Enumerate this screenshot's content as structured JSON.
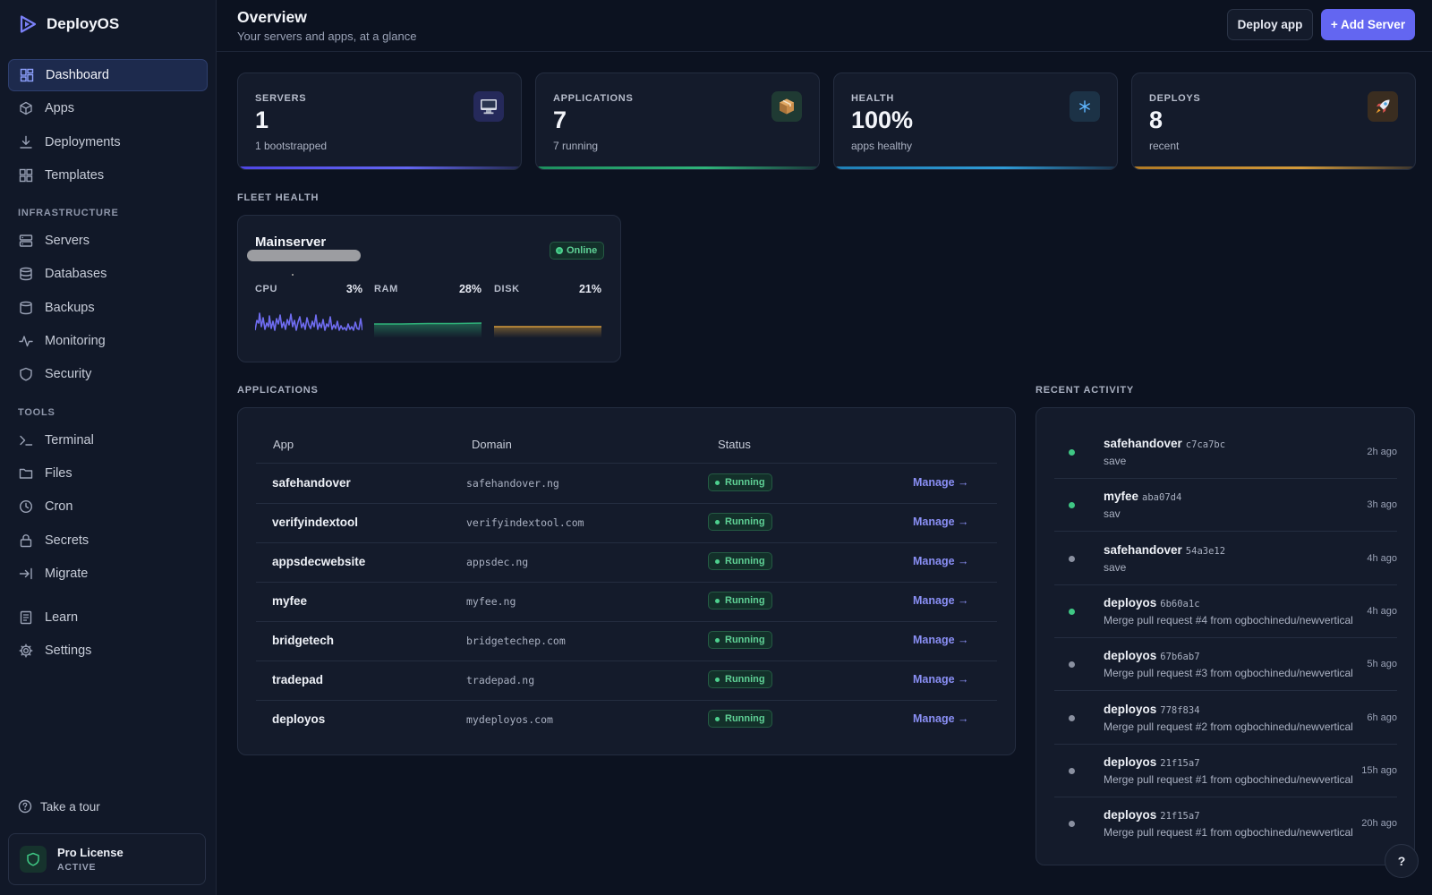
{
  "app": {
    "name": "DeployOS"
  },
  "nav": {
    "main": [
      {
        "label": "Dashboard",
        "icon": "dashboard-icon",
        "active": true
      },
      {
        "label": "Apps",
        "icon": "cube-icon"
      },
      {
        "label": "Deployments",
        "icon": "download-icon"
      },
      {
        "label": "Templates",
        "icon": "grid-icon"
      }
    ],
    "infrastructure_label": "INFRASTRUCTURE",
    "infrastructure": [
      {
        "label": "Servers",
        "icon": "server-icon"
      },
      {
        "label": "Databases",
        "icon": "database-icon"
      },
      {
        "label": "Backups",
        "icon": "backup-icon"
      },
      {
        "label": "Monitoring",
        "icon": "activity-icon"
      },
      {
        "label": "Security",
        "icon": "shield-icon"
      }
    ],
    "tools_label": "TOOLS",
    "tools": [
      {
        "label": "Terminal",
        "icon": "terminal-icon"
      },
      {
        "label": "Files",
        "icon": "folder-icon"
      },
      {
        "label": "Cron",
        "icon": "clock-icon"
      },
      {
        "label": "Secrets",
        "icon": "lock-icon"
      },
      {
        "label": "Migrate",
        "icon": "migrate-icon"
      }
    ],
    "bottom": [
      {
        "label": "Learn",
        "icon": "book-icon"
      },
      {
        "label": "Settings",
        "icon": "gear-icon"
      }
    ],
    "tour_label": "Take a tour",
    "license": {
      "title": "Pro License",
      "status": "ACTIVE"
    }
  },
  "header": {
    "title": "Overview",
    "subtitle": "Your servers and apps, at a glance",
    "deploy_label": "Deploy app",
    "add_server_label": "+ Add Server"
  },
  "stats": [
    {
      "label": "SERVERS",
      "value": "1",
      "sub": "1 bootstrapped",
      "icon": "monitor-icon",
      "accent": "#6366f1",
      "icon_bg": "#25295a"
    },
    {
      "label": "APPLICATIONS",
      "value": "7",
      "sub": "7 running",
      "icon": "package-icon",
      "accent": "#2fb37a",
      "icon_bg": "#1f3a33"
    },
    {
      "label": "HEALTH",
      "value": "100%",
      "sub": "apps healthy",
      "icon": "snowflake-icon",
      "accent": "#2f9bd6",
      "icon_bg": "#1c3246"
    },
    {
      "label": "DEPLOYS",
      "value": "8",
      "sub": "recent",
      "icon": "rocket-icon",
      "accent": "#d39a3a",
      "icon_bg": "#3a2d20"
    }
  ],
  "fleet": {
    "section_label": "FLEET HEALTH",
    "server_name": "Mainserver",
    "status": "Online",
    "metrics": [
      {
        "label": "CPU",
        "value": "3%",
        "color": "#6f6cf0",
        "percent": 3
      },
      {
        "label": "RAM",
        "value": "28%",
        "color": "#2fb37a",
        "percent": 28
      },
      {
        "label": "DISK",
        "value": "21%",
        "color": "#d39a3a",
        "percent": 21
      }
    ]
  },
  "applications": {
    "section_label": "APPLICATIONS",
    "headers": [
      "App",
      "Domain",
      "Status"
    ],
    "manage_label": "Manage →",
    "rows": [
      {
        "app": "safehandover",
        "domain": "safehandover.ng",
        "status": "Running"
      },
      {
        "app": "verifyindextool",
        "domain": "verifyindextool.com",
        "status": "Running"
      },
      {
        "app": "appsdecwebsite",
        "domain": "appsdec.ng",
        "status": "Running"
      },
      {
        "app": "myfee",
        "domain": "myfee.ng",
        "status": "Running"
      },
      {
        "app": "bridgetech",
        "domain": "bridgetechep.com",
        "status": "Running"
      },
      {
        "app": "tradepad",
        "domain": "tradepad.ng",
        "status": "Running"
      },
      {
        "app": "deployos",
        "domain": "mydeployos.com",
        "status": "Running"
      }
    ]
  },
  "activity": {
    "section_label": "RECENT ACTIVITY",
    "items": [
      {
        "name": "safehandover",
        "hash": "c7ca7bc",
        "message": "save",
        "time": "2h ago",
        "dot": "#3fc784"
      },
      {
        "name": "myfee",
        "hash": "aba07d4",
        "message": "sav",
        "time": "3h ago",
        "dot": "#3fc784"
      },
      {
        "name": "safehandover",
        "hash": "54a3e12",
        "message": "save",
        "time": "4h ago",
        "dot": "#8a90a0"
      },
      {
        "name": "deployos",
        "hash": "6b60a1c",
        "message": "Merge pull request #4 from ogbochinedu/newvertical",
        "time": "4h ago",
        "dot": "#3fc784"
      },
      {
        "name": "deployos",
        "hash": "67b6ab7",
        "message": "Merge pull request #3 from ogbochinedu/newvertical",
        "time": "5h ago",
        "dot": "#8a90a0"
      },
      {
        "name": "deployos",
        "hash": "778f834",
        "message": "Merge pull request #2 from ogbochinedu/newvertical",
        "time": "6h ago",
        "dot": "#8a90a0"
      },
      {
        "name": "deployos",
        "hash": "21f15a7",
        "message": "Merge pull request #1 from ogbochinedu/newvertical",
        "time": "15h ago",
        "dot": "#8a90a0"
      },
      {
        "name": "deployos",
        "hash": "21f15a7",
        "message": "Merge pull request #1 from ogbochinedu/newvertical",
        "time": "20h ago",
        "dot": "#8a90a0"
      }
    ]
  },
  "help_label": "?"
}
